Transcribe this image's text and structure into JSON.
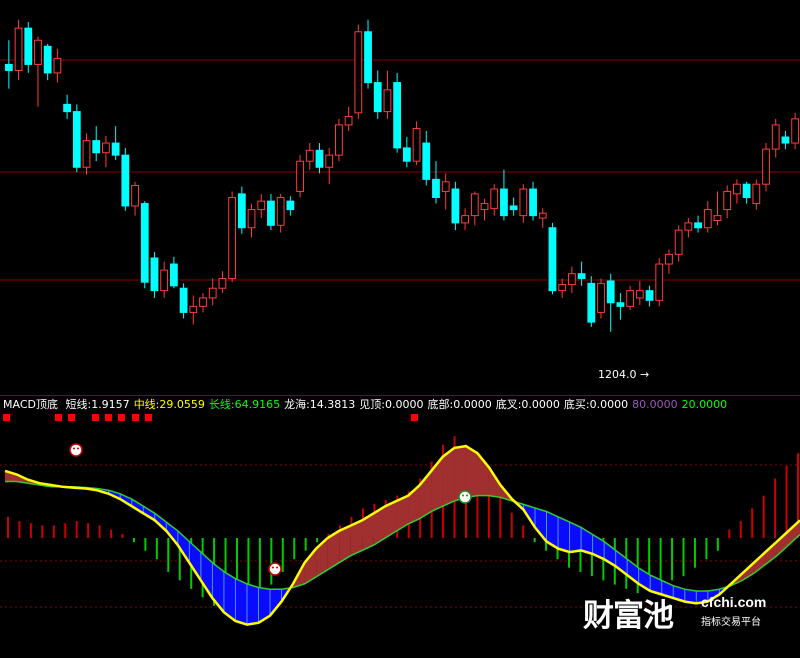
{
  "chart_data": [
    {
      "type": "candlestick",
      "title": "",
      "ylim": [
        1160,
        1470
      ],
      "grid": true,
      "colors": {
        "up": "#ff3b3b",
        "down": "#00ffff",
        "grid": "#8b0000",
        "background": "#000000"
      },
      "low_annotation": {
        "label": "1204.0",
        "value": 1204.0
      },
      "ohlc": [
        [
          1425,
          1445,
          1405,
          1420
        ],
        [
          1420,
          1462,
          1412,
          1455
        ],
        [
          1455,
          1460,
          1418,
          1425
        ],
        [
          1425,
          1448,
          1390,
          1445
        ],
        [
          1440,
          1442,
          1412,
          1418
        ],
        [
          1418,
          1438,
          1410,
          1430
        ],
        [
          1392,
          1400,
          1380,
          1386
        ],
        [
          1386,
          1392,
          1336,
          1340
        ],
        [
          1340,
          1368,
          1334,
          1362
        ],
        [
          1362,
          1374,
          1345,
          1352
        ],
        [
          1352,
          1366,
          1340,
          1360
        ],
        [
          1360,
          1374,
          1346,
          1350
        ],
        [
          1350,
          1356,
          1304,
          1308
        ],
        [
          1308,
          1328,
          1300,
          1325
        ],
        [
          1310,
          1312,
          1240,
          1245
        ],
        [
          1265,
          1270,
          1232,
          1238
        ],
        [
          1238,
          1262,
          1232,
          1255
        ],
        [
          1260,
          1266,
          1240,
          1242
        ],
        [
          1240,
          1244,
          1215,
          1220
        ],
        [
          1220,
          1234,
          1210,
          1225
        ],
        [
          1225,
          1236,
          1220,
          1232
        ],
        [
          1232,
          1248,
          1226,
          1240
        ],
        [
          1240,
          1254,
          1236,
          1248
        ],
        [
          1248,
          1320,
          1245,
          1315
        ],
        [
          1318,
          1324,
          1285,
          1290
        ],
        [
          1290,
          1310,
          1282,
          1305
        ],
        [
          1305,
          1318,
          1298,
          1312
        ],
        [
          1312,
          1318,
          1288,
          1292
        ],
        [
          1292,
          1318,
          1286,
          1315
        ],
        [
          1312,
          1316,
          1300,
          1305
        ],
        [
          1320,
          1350,
          1315,
          1345
        ],
        [
          1345,
          1360,
          1338,
          1354
        ],
        [
          1354,
          1360,
          1335,
          1340
        ],
        [
          1340,
          1356,
          1326,
          1350
        ],
        [
          1350,
          1380,
          1345,
          1375
        ],
        [
          1375,
          1390,
          1370,
          1382
        ],
        [
          1385,
          1458,
          1380,
          1452
        ],
        [
          1452,
          1462,
          1405,
          1410
        ],
        [
          1410,
          1420,
          1380,
          1386
        ],
        [
          1386,
          1420,
          1380,
          1404
        ],
        [
          1410,
          1418,
          1352,
          1356
        ],
        [
          1356,
          1365,
          1340,
          1345
        ],
        [
          1345,
          1378,
          1342,
          1372
        ],
        [
          1360,
          1370,
          1325,
          1330
        ],
        [
          1330,
          1345,
          1310,
          1315
        ],
        [
          1320,
          1335,
          1305,
          1328
        ],
        [
          1322,
          1328,
          1288,
          1294
        ],
        [
          1294,
          1306,
          1288,
          1300
        ],
        [
          1300,
          1320,
          1292,
          1318
        ],
        [
          1305,
          1314,
          1296,
          1310
        ],
        [
          1306,
          1326,
          1300,
          1322
        ],
        [
          1322,
          1338,
          1296,
          1300
        ],
        [
          1308,
          1315,
          1300,
          1305
        ],
        [
          1300,
          1326,
          1294,
          1322
        ],
        [
          1322,
          1328,
          1296,
          1300
        ],
        [
          1298,
          1306,
          1290,
          1302
        ],
        [
          1290,
          1294,
          1235,
          1238
        ],
        [
          1238,
          1248,
          1232,
          1243
        ],
        [
          1243,
          1258,
          1236,
          1252
        ],
        [
          1252,
          1262,
          1242,
          1248
        ],
        [
          1244,
          1250,
          1208,
          1212
        ],
        [
          1220,
          1248,
          1215,
          1244
        ],
        [
          1246,
          1252,
          1204,
          1228
        ],
        [
          1228,
          1236,
          1214,
          1225
        ],
        [
          1225,
          1242,
          1222,
          1238
        ],
        [
          1232,
          1246,
          1226,
          1238
        ],
        [
          1238,
          1242,
          1225,
          1230
        ],
        [
          1230,
          1265,
          1225,
          1260
        ],
        [
          1260,
          1272,
          1252,
          1268
        ],
        [
          1268,
          1292,
          1262,
          1288
        ],
        [
          1288,
          1298,
          1282,
          1294
        ],
        [
          1294,
          1300,
          1286,
          1290
        ],
        [
          1290,
          1312,
          1286,
          1305
        ],
        [
          1296,
          1320,
          1292,
          1300
        ],
        [
          1305,
          1325,
          1298,
          1320
        ],
        [
          1318,
          1330,
          1310,
          1326
        ],
        [
          1326,
          1328,
          1310,
          1315
        ],
        [
          1310,
          1330,
          1305,
          1326
        ],
        [
          1326,
          1360,
          1320,
          1355
        ],
        [
          1355,
          1380,
          1348,
          1375
        ],
        [
          1365,
          1370,
          1355,
          1360
        ],
        [
          1360,
          1385,
          1355,
          1380
        ]
      ]
    },
    {
      "type": "indicator",
      "name": "MACD顶底",
      "ylim": [
        -3,
        3
      ],
      "series": [
        {
          "label": "短线:",
          "value": "1.9157",
          "color": "#ffffff"
        },
        {
          "label": "中线:",
          "value": "29.0559",
          "color": "#ffff00"
        },
        {
          "label": "长线:",
          "value": "64.9165",
          "color": "#00ff00"
        },
        {
          "label": "龙海:",
          "value": "14.3813",
          "color": "#ffffff"
        },
        {
          "label": "见顶:",
          "value": "0.0000",
          "color": "#ffffff"
        },
        {
          "label": "底部:",
          "value": "0.0000",
          "color": "#ffffff"
        },
        {
          "label": "底叉:",
          "value": "0.0000",
          "color": "#ffffff"
        },
        {
          "label": "底买:",
          "value": "0.0000",
          "color": "#ffffff"
        },
        {
          "label": "",
          "value": "80.0000",
          "color": "#9b59b6"
        },
        {
          "label": "",
          "value": "20.0000",
          "color": "#00ff00"
        }
      ],
      "fast_line": [
        1.9,
        1.8,
        1.65,
        1.55,
        1.5,
        1.45,
        1.42,
        1.4,
        1.35,
        1.25,
        1.1,
        0.9,
        0.7,
        0.5,
        0.2,
        -0.2,
        -0.7,
        -1.2,
        -1.7,
        -2.1,
        -2.35,
        -2.45,
        -2.4,
        -2.2,
        -1.8,
        -1.3,
        -0.7,
        -0.3,
        0.0,
        0.2,
        0.35,
        0.5,
        0.7,
        0.9,
        1.05,
        1.2,
        1.5,
        1.9,
        2.3,
        2.55,
        2.6,
        2.4,
        2.0,
        1.5,
        1.1,
        0.8,
        0.3,
        -0.1,
        -0.3,
        -0.4,
        -0.35,
        -0.45,
        -0.6,
        -0.8,
        -1.05,
        -1.3,
        -1.5,
        -1.6,
        -1.7,
        -1.8,
        -1.85,
        -1.8,
        -1.6,
        -1.3,
        -1.0,
        -0.7,
        -0.4,
        -0.1,
        0.2,
        0.5
      ],
      "slow_line": [
        1.6,
        1.6,
        1.55,
        1.5,
        1.45,
        1.45,
        1.45,
        1.43,
        1.4,
        1.35,
        1.25,
        1.1,
        0.9,
        0.7,
        0.45,
        0.2,
        -0.1,
        -0.4,
        -0.7,
        -0.95,
        -1.15,
        -1.3,
        -1.4,
        -1.45,
        -1.45,
        -1.4,
        -1.3,
        -1.1,
        -0.9,
        -0.7,
        -0.5,
        -0.35,
        -0.2,
        0.0,
        0.2,
        0.4,
        0.55,
        0.75,
        0.9,
        1.05,
        1.15,
        1.2,
        1.2,
        1.15,
        1.05,
        0.95,
        0.85,
        0.75,
        0.6,
        0.45,
        0.3,
        0.1,
        -0.1,
        -0.35,
        -0.6,
        -0.85,
        -1.05,
        -1.2,
        -1.35,
        -1.45,
        -1.5,
        -1.5,
        -1.45,
        -1.35,
        -1.2,
        -1.0,
        -0.75,
        -0.5,
        -0.2,
        0.1
      ],
      "histogram": [
        0.5,
        0.4,
        0.35,
        0.3,
        0.3,
        0.35,
        0.4,
        0.35,
        0.3,
        0.2,
        0.1,
        -0.1,
        -0.3,
        -0.5,
        -0.8,
        -1.0,
        -1.2,
        -1.4,
        -1.6,
        -1.7,
        -1.6,
        -1.5,
        -1.4,
        -1.1,
        -0.8,
        -0.5,
        -0.3,
        -0.1,
        0.1,
        0.3,
        0.5,
        0.7,
        0.8,
        0.9,
        1.0,
        1.1,
        1.4,
        1.8,
        2.2,
        2.4,
        2.2,
        1.8,
        1.4,
        1.0,
        0.6,
        0.3,
        -0.1,
        -0.3,
        -0.5,
        -0.7,
        -0.8,
        -0.9,
        -1.0,
        -1.1,
        -1.2,
        -1.3,
        -1.2,
        -1.1,
        -1.0,
        -0.9,
        -0.7,
        -0.5,
        -0.3,
        0.2,
        0.4,
        0.7,
        1.0,
        1.4,
        1.7,
        2.0
      ],
      "signal_markers": [
        3,
        55,
        68,
        92,
        105,
        118,
        132,
        145,
        411
      ],
      "colors": {
        "bull_fill": "#a03030",
        "bear_fill": "#0a0aff",
        "fast": "#ffff00",
        "slow": "#33cc33",
        "hist_up": "#cc0000",
        "hist_down": "#00cc00",
        "level": "#8b0000"
      }
    }
  ],
  "watermark": {
    "brand": "财富池",
    "url": "cfchi.com",
    "tagline": "指标交易平台"
  }
}
